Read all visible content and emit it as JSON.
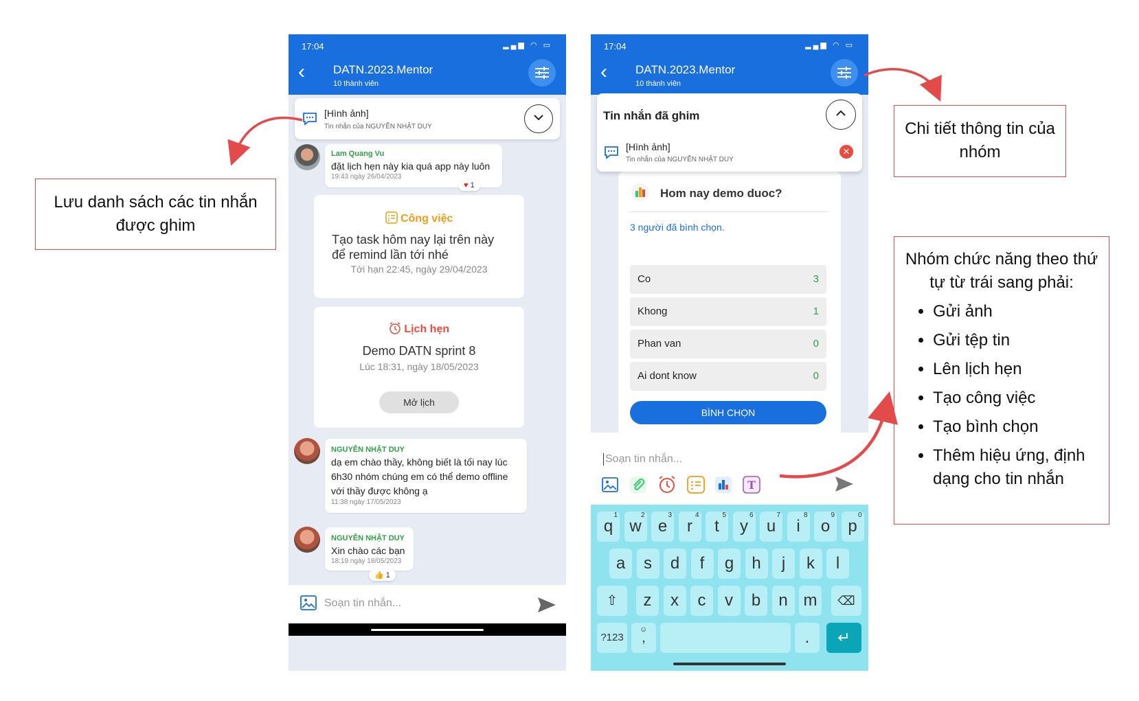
{
  "left_phone": {
    "status_time": "17:04",
    "group_title": "DATN.2023.Mentor",
    "group_members": "10 thành viên",
    "pinned_bar": {
      "title": "[Hình ảnh]",
      "sub": "Tin nhắn của NGUYỄN NHẬT DUY"
    },
    "msg1": {
      "sender": "Lam Quang Vu",
      "text": "đặt lịch hẹn này kia quá app này luôn",
      "time": "19:43 ngày 26/04/2023",
      "reaction": "1"
    },
    "task_card": {
      "label": "Công việc",
      "text": "Tạo task hôm nay lại trên này để remind lần tới nhé",
      "deadline": "Tới hạn 22:45, ngày 29/04/2023"
    },
    "event_card": {
      "label": "Lịch hẹn",
      "title": "Demo DATN sprint 8",
      "time": "Lúc 18:31, ngày 18/05/2023",
      "button": "Mở lịch"
    },
    "msg2": {
      "sender": "NGUYỄN NHẬT DUY",
      "text": "dạ em chào thầy, không biết là tối nay lúc 6h30 nhóm chúng em có thể demo offline với thầy được không ạ",
      "time": "11:38 ngày 17/05/2023"
    },
    "msg3": {
      "sender": "NGUYỄN NHẬT DUY",
      "text": "Xin chào các bạn",
      "time": "18:19 ngày 18/05/2023",
      "reaction": "1"
    },
    "composer_placeholder": "Soạn tin nhắn..."
  },
  "right_phone": {
    "status_time": "17:04",
    "group_title": "DATN.2023.Mentor",
    "group_members": "10 thành viên",
    "pinned_panel": {
      "title": "Tin nhắn đã ghim",
      "item_title": "[Hình ảnh]",
      "item_sub": "Tin nhắn của NGUYỄN NHẬT DUY"
    },
    "poll": {
      "question": "Hom nay demo duoc?",
      "voters": "3 người đã bình chọn.",
      "options": [
        {
          "label": "Co",
          "count": "3"
        },
        {
          "label": "Khong",
          "count": "1"
        },
        {
          "label": "Phan van",
          "count": "0"
        },
        {
          "label": "Ai dont know",
          "count": "0"
        }
      ],
      "button": "BÌNH CHỌN"
    },
    "composer_placeholder": "Soạn tin nhắn...",
    "keyboard": {
      "row1": [
        "q",
        "w",
        "e",
        "r",
        "t",
        "y",
        "u",
        "i",
        "o",
        "p"
      ],
      "row1_nums": [
        "1",
        "2",
        "3",
        "4",
        "5",
        "6",
        "7",
        "8",
        "9",
        "0"
      ],
      "row2": [
        "a",
        "s",
        "d",
        "f",
        "g",
        "h",
        "j",
        "k",
        "l"
      ],
      "row3": [
        "z",
        "x",
        "c",
        "v",
        "b",
        "n",
        "m"
      ],
      "sym_key": "?123",
      "comma": ",",
      "period": "."
    }
  },
  "annotations": {
    "pinned_list": "Lưu danh sách các tin nhắn được ghim",
    "group_info": "Chi tiết thông tin của nhóm",
    "toolbar_intro": "Nhóm chức năng theo thứ tự từ trái sang phải:",
    "toolbar_items": [
      "Gửi ảnh",
      "Gửi tệp tin",
      "Lên lịch hẹn",
      "Tạo công việc",
      "Tạo bình chọn",
      "Thêm hiệu ứng, định dạng cho tin nhắn"
    ]
  },
  "colors": {
    "brand_blue": "#1a6fdf",
    "accent_red": "#e34a4a",
    "sender_green": "#2e9f46",
    "task_orange": "#f39c12",
    "event_red": "#e74c3c",
    "keyboard_bg": "#8ee3ef"
  }
}
